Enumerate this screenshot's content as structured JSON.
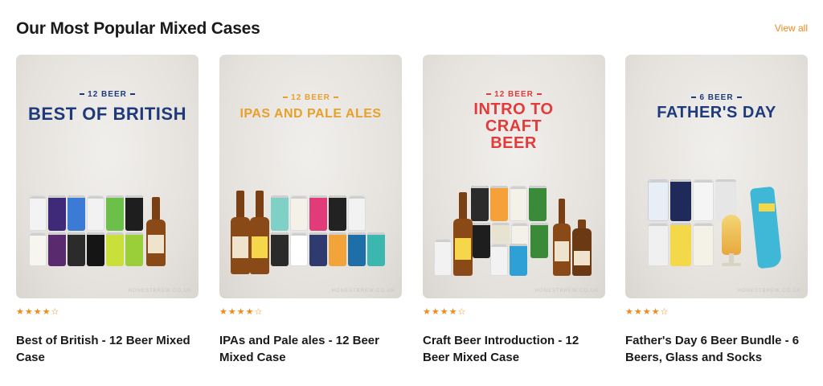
{
  "section": {
    "title": "Our Most Popular Mixed Cases",
    "view_all": "View all"
  },
  "products": [
    {
      "image_kicker": "12 BEER",
      "image_headline": "BEST OF BRITISH",
      "headline_color": "#1f3a7a",
      "kicker_color": "#1f3a7a",
      "watermark": "HONESTBREW.CO.UK",
      "rating": "★★★★☆",
      "name": "Best of British - 12 Beer Mixed Case"
    },
    {
      "image_kicker": "12 BEER",
      "image_headline": "IPAS AND PALE ALES",
      "headline_color": "#e8a02a",
      "kicker_color": "#e8a02a",
      "watermark": "HONESTBREW.CO.UK",
      "rating": "★★★★☆",
      "name": "IPAs and Pale ales - 12 Beer Mixed Case"
    },
    {
      "image_kicker": "12 BEER",
      "image_headline": "INTRO TO CRAFT BEER",
      "headline_color": "#e23b3b",
      "kicker_color": "#e23b3b",
      "watermark": "HONESTBREW.CO.UK",
      "rating": "★★★★☆",
      "name": "Craft Beer Introduction - 12 Beer Mixed Case"
    },
    {
      "image_kicker": "6 BEER",
      "image_headline": "FATHER'S DAY",
      "headline_color": "#1f3a7a",
      "kicker_color": "#1f3a7a",
      "watermark": "HONESTBREW.CO.UK",
      "rating": "★★★★☆",
      "name": "Father's Day 6 Beer Bundle - 6 Beers, Glass and Socks"
    }
  ],
  "accent_color": "#f08a1c"
}
